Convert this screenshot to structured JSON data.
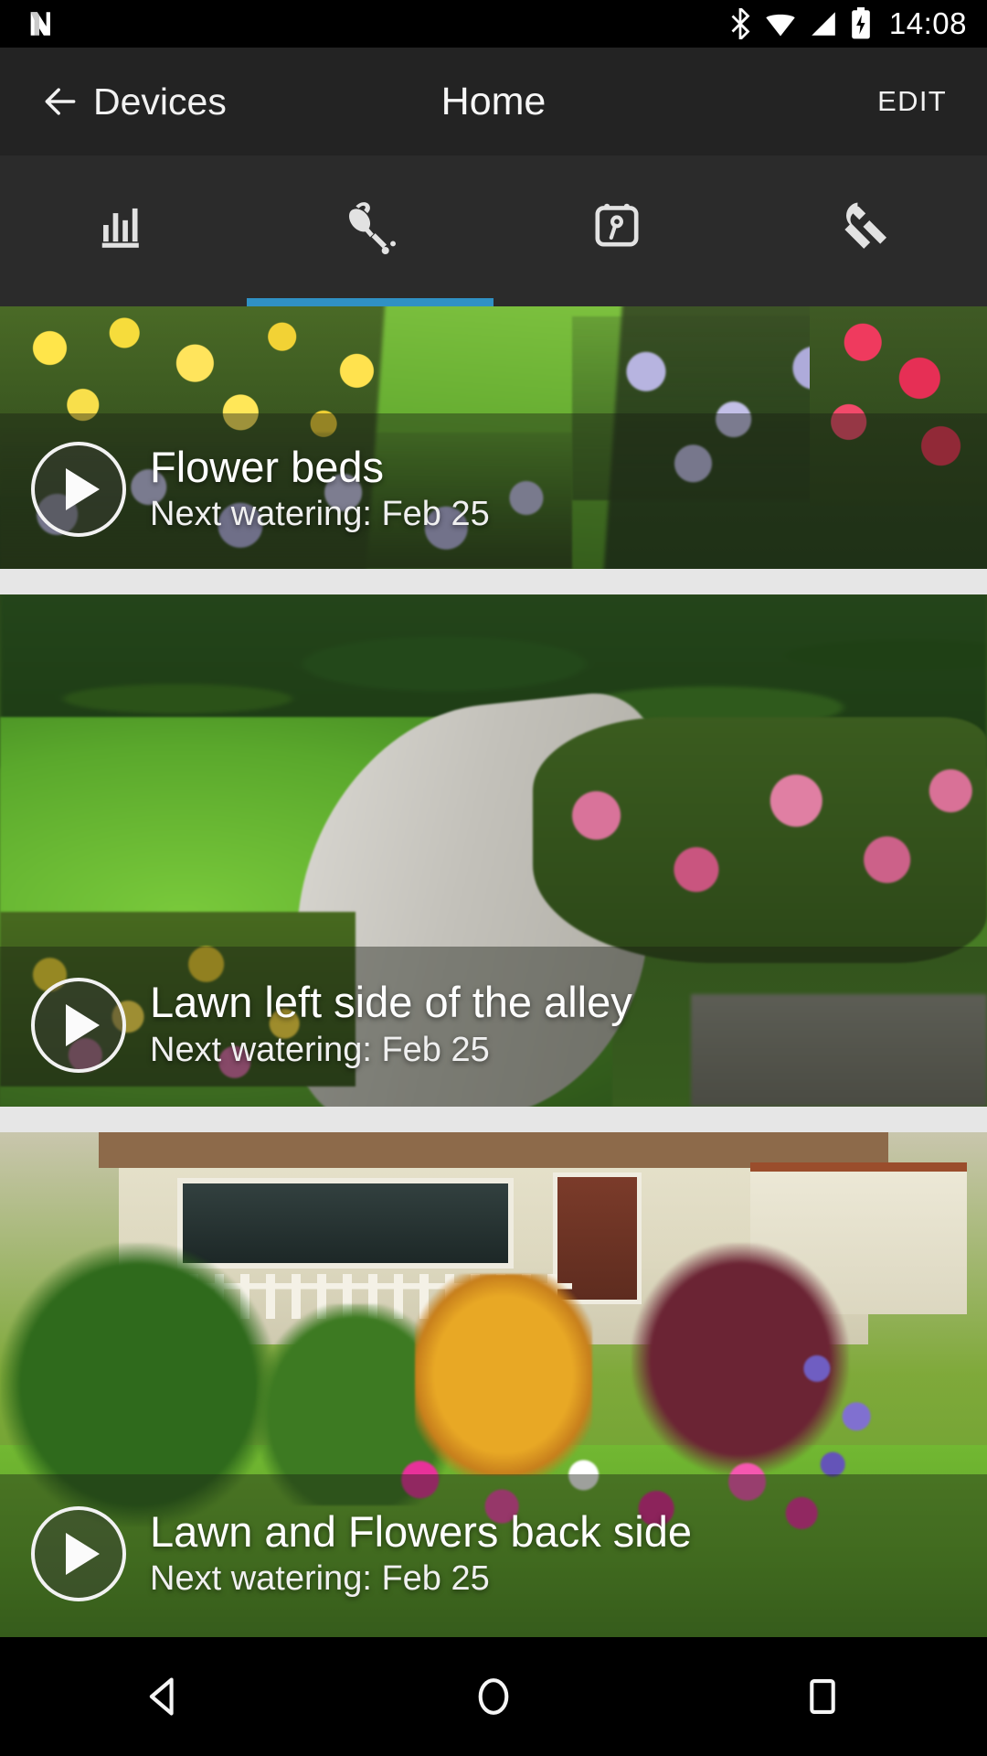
{
  "statusbar": {
    "time": "14:08",
    "icons": [
      "nvidia-n-logo",
      "bluetooth-icon",
      "wifi-icon",
      "cellular-signal-icon",
      "battery-charging-icon"
    ]
  },
  "appbar": {
    "back_icon": "arrow-left-icon",
    "back_label": "Devices",
    "title": "Home",
    "action_label": "EDIT",
    "background_color": "#232323"
  },
  "tabs": {
    "active_index": 1,
    "indicator_color": "#3091c4",
    "items": [
      {
        "name": "statistics",
        "icon": "bar-chart-icon"
      },
      {
        "name": "watering",
        "icon": "watering-can-icon"
      },
      {
        "name": "schedule",
        "icon": "calendar-clock-icon"
      },
      {
        "name": "settings",
        "icon": "wrench-icon"
      }
    ]
  },
  "zones": [
    {
      "title": "Flower beds",
      "subtitle": "Next watering: Feb 25",
      "play_icon": "play-circle-icon"
    },
    {
      "title": "Lawn left side of the alley",
      "subtitle": "Next watering: Feb 25",
      "play_icon": "play-circle-icon"
    },
    {
      "title": "Lawn and Flowers back side",
      "subtitle": "Next watering: Feb 25",
      "play_icon": "play-circle-icon"
    }
  ],
  "navbar": {
    "back": "triangle-back-icon",
    "home": "circle-home-icon",
    "recents": "square-recents-icon"
  }
}
